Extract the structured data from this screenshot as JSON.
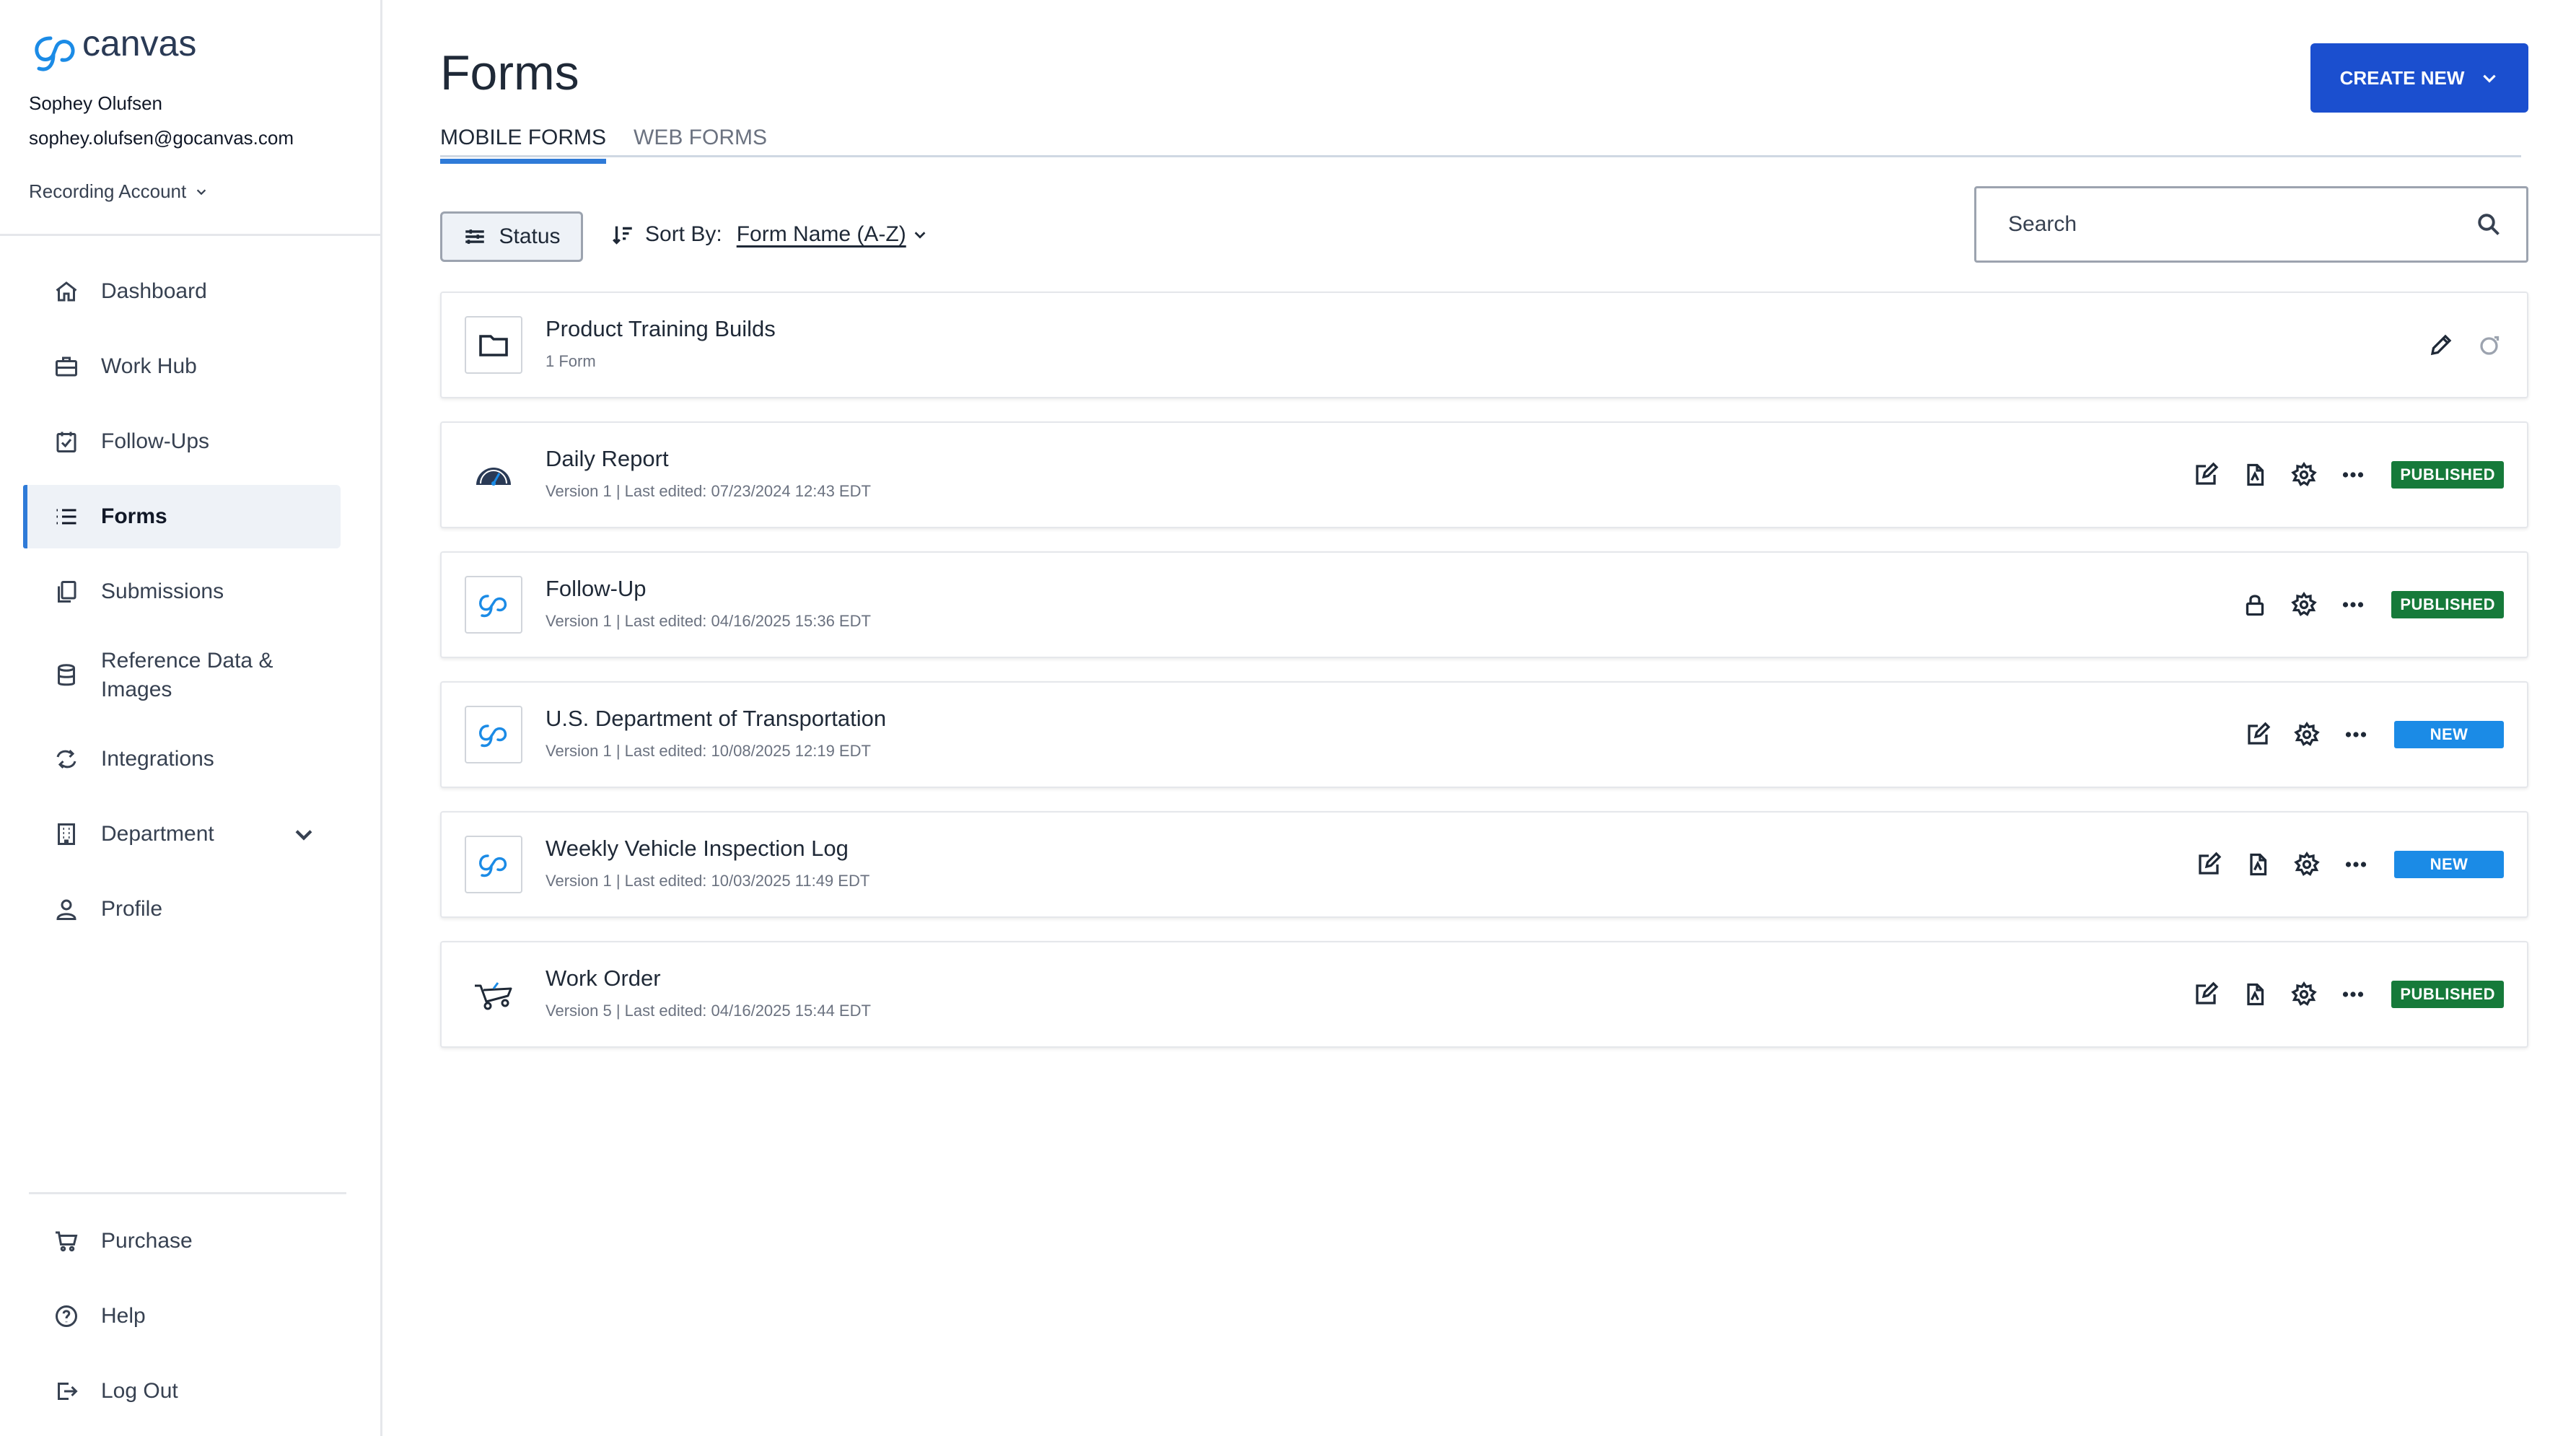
{
  "brand": {
    "logo_text": "gocanvas",
    "accent": "#1b8be6",
    "primary": "#1b4fcf"
  },
  "user": {
    "name": "Sophey Olufsen",
    "email": "sophey.olufsen@gocanvas.com",
    "account": "Recording Account"
  },
  "nav": {
    "items": [
      {
        "label": "Dashboard",
        "icon": "home-icon"
      },
      {
        "label": "Work Hub",
        "icon": "briefcase-icon"
      },
      {
        "label": "Follow-Ups",
        "icon": "calendar-check-icon"
      },
      {
        "label": "Forms",
        "icon": "list-icon",
        "active": true
      },
      {
        "label": "Submissions",
        "icon": "copy-icon"
      },
      {
        "label": "Reference Data & Images",
        "icon": "database-icon"
      },
      {
        "label": "Integrations",
        "icon": "sync-icon"
      },
      {
        "label": "Department",
        "icon": "building-icon"
      },
      {
        "label": "Profile",
        "icon": "user-icon"
      }
    ],
    "bottom": [
      {
        "label": "Purchase",
        "icon": "cart-icon"
      },
      {
        "label": "Help",
        "icon": "help-icon"
      },
      {
        "label": "Log Out",
        "icon": "logout-icon"
      }
    ]
  },
  "page": {
    "title": "Forms",
    "create_label": "CREATE NEW",
    "tabs": [
      "MOBILE FORMS",
      "WEB FORMS"
    ],
    "status_label": "Status",
    "sort_label": "Sort By:",
    "sort_value": "Form Name (A-Z)",
    "search_placeholder": "Search"
  },
  "rows": [
    {
      "title": "Product Training Builds",
      "subtitle": "1 Form",
      "icon": "folder-icon",
      "badge": ""
    },
    {
      "title": "Daily Report",
      "subtitle": "Version 1 | Last edited: 07/23/2024 12:43 EDT",
      "icon": "gauge-icon",
      "badge": "PUBLISHED"
    },
    {
      "title": "Follow-Up",
      "subtitle": "Version 1 | Last edited: 04/16/2025 15:36 EDT",
      "icon": "gocanvas-icon",
      "badge": "PUBLISHED"
    },
    {
      "title": "U.S. Department of Transportation",
      "subtitle": "Version 1 | Last edited: 10/08/2025 12:19 EDT",
      "icon": "gocanvas-icon",
      "badge": "NEW"
    },
    {
      "title": "Weekly Vehicle Inspection Log",
      "subtitle": "Version 1 | Last edited: 10/03/2025 11:49 EDT",
      "icon": "gocanvas-icon",
      "badge": "NEW"
    },
    {
      "title": "Work Order",
      "subtitle": "Version 5 | Last edited: 04/16/2025 15:44 EDT",
      "icon": "wheelbarrow-icon",
      "badge": "PUBLISHED"
    }
  ]
}
